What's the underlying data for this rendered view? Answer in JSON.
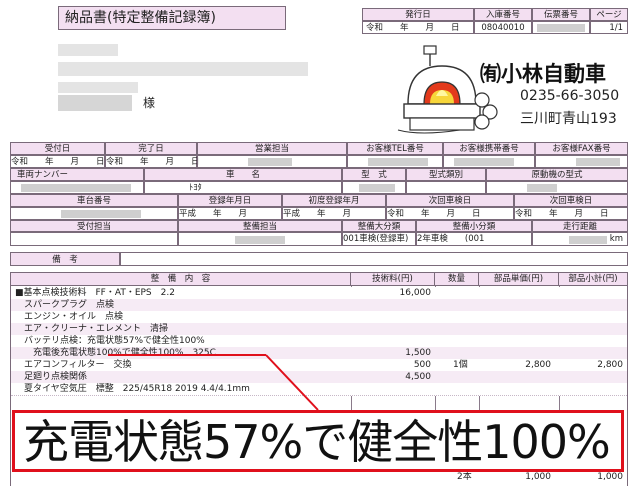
{
  "doc": {
    "title": "納品書(特定整備記録簿)",
    "header_labels": [
      "発行日",
      "入庫番号",
      "伝票番号",
      "ページ"
    ],
    "header_values": [
      "令和　　年　　月　　日",
      "08040010",
      "",
      "1/1"
    ],
    "customer_suffix": "様"
  },
  "shop": {
    "name": "㈲小林自動車",
    "phone": "0235-66-3050",
    "address": "三川町青山193"
  },
  "info": {
    "received_label": "受付日",
    "completed_label": "完了日",
    "received_value": "令和　　年　　月　　日",
    "completed_value": "令和　　年　　月　　日",
    "staff_label": "営業担当",
    "tel_label": "お客様TEL番号",
    "mobile_label": "お客様携帯番号",
    "fax_label": "お客様FAX番号",
    "plate_label": "車両ナンバー",
    "car_label": "車　　名",
    "car_value": "ﾄﾖﾀ",
    "model_label": "型　式",
    "type_label": "型式類別",
    "engine_label": "原動機の型式",
    "chassis_label": "車台番号",
    "reg_label": "登録年月日",
    "reg_value": "平成　　年　　月",
    "first_reg_label": "初度登録年月",
    "first_reg_value": "平成　　年　　月",
    "next_label": "次回車検日",
    "next_value": "令和　　年　　月　　日",
    "next2_label": "次回車検日",
    "next2_value": "令和　　年　　月　　日",
    "reception_label": "受付担当",
    "mechanic_label": "整備担当",
    "major_label": "整備大分類",
    "major_value": "001車検(登録車)",
    "minor_label": "整備小分類",
    "minor_value": "2年車検　　(001",
    "mileage_label": "走行距離",
    "mileage_unit": "km",
    "remarks_label": "備　考"
  },
  "table": {
    "headers": [
      "整　備　内　容",
      "技術料(円)",
      "数量",
      "部品単価(円)",
      "部品小計(円)"
    ],
    "rows": [
      {
        "desc": "■基本点検技術料　FF・AT・EPS　2.2",
        "tech": "16,000",
        "qty": "",
        "unit": "",
        "sub": ""
      },
      {
        "desc": "　スパークプラグ　点検",
        "tech": "",
        "qty": "",
        "unit": "",
        "sub": ""
      },
      {
        "desc": "　エンジン・オイル　点検",
        "tech": "",
        "qty": "",
        "unit": "",
        "sub": ""
      },
      {
        "desc": "　エア・クリーナ・エレメント　清掃",
        "tech": "",
        "qty": "",
        "unit": "",
        "sub": ""
      },
      {
        "desc": "　バッテリ点検：充電状態57%で健全性100%",
        "tech": "",
        "qty": "",
        "unit": "",
        "sub": ""
      },
      {
        "desc": "　　充電後充電状態100%で健全性100%　325C",
        "tech": "1,500",
        "qty": "",
        "unit": "",
        "sub": ""
      },
      {
        "desc": "　エアコンフィルター　交換",
        "tech": "500",
        "qty": "1個",
        "unit": "2,800",
        "sub": "2,800"
      },
      {
        "desc": "　足廻り点検関係",
        "tech": "4,500",
        "qty": "",
        "unit": "",
        "sub": ""
      },
      {
        "desc": "　夏タイヤ空気圧　標整　225/45R18 2019 4.4/4.1mm",
        "tech": "",
        "qty": "",
        "unit": "",
        "sub": ""
      }
    ],
    "partial_row": {
      "qty": "2本",
      "unit": "1,000",
      "sub": "1,000"
    }
  },
  "callout": {
    "text": "充電状態57%で健全性100%",
    "color": "#e0101c"
  }
}
